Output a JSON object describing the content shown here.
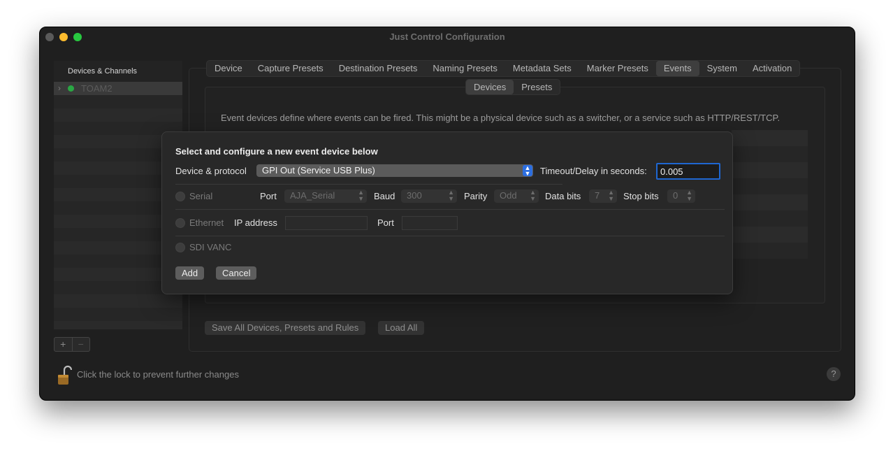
{
  "window": {
    "title": "Just Control Configuration"
  },
  "sidebar": {
    "header": "Devices & Channels",
    "items": [
      {
        "label": "TOAM2",
        "status_color": "#2aa744"
      }
    ],
    "add_label": "+",
    "remove_label": "−"
  },
  "tabs": [
    "Device",
    "Capture Presets",
    "Destination Presets",
    "Naming Presets",
    "Metadata Sets",
    "Marker Presets",
    "Events",
    "System",
    "Activation"
  ],
  "active_tab": "Events",
  "subtabs": [
    "Devices",
    "Presets"
  ],
  "active_subtab": "Devices",
  "events": {
    "description": "Event devices define where events can be fired. This might be a physical device such as a switcher, or a service such as HTTP/REST/TCP."
  },
  "bottom": {
    "save_all": "Save All Devices, Presets and Rules",
    "load_all": "Load All",
    "lock_text": "Click the lock to prevent further changes",
    "help": "?"
  },
  "sheet": {
    "heading": "Select and configure a new event device below",
    "device_protocol_label": "Device & protocol",
    "device_protocol_value": "GPI Out (Service USB Plus)",
    "timeout_label": "Timeout/Delay in seconds:",
    "timeout_value": "0.005",
    "serial": {
      "label": "Serial",
      "port_label": "Port",
      "port_value": "AJA_Serial",
      "baud_label": "Baud",
      "baud_value": "300",
      "parity_label": "Parity",
      "parity_value": "Odd",
      "databits_label": "Data bits",
      "databits_value": "7",
      "stopbits_label": "Stop bits",
      "stopbits_value": "0"
    },
    "ethernet": {
      "label": "Ethernet",
      "ip_label": "IP address",
      "ip_value": "",
      "port_label": "Port",
      "port_value": ""
    },
    "sdi": {
      "label": "SDI VANC"
    },
    "add_button": "Add",
    "cancel_button": "Cancel"
  }
}
